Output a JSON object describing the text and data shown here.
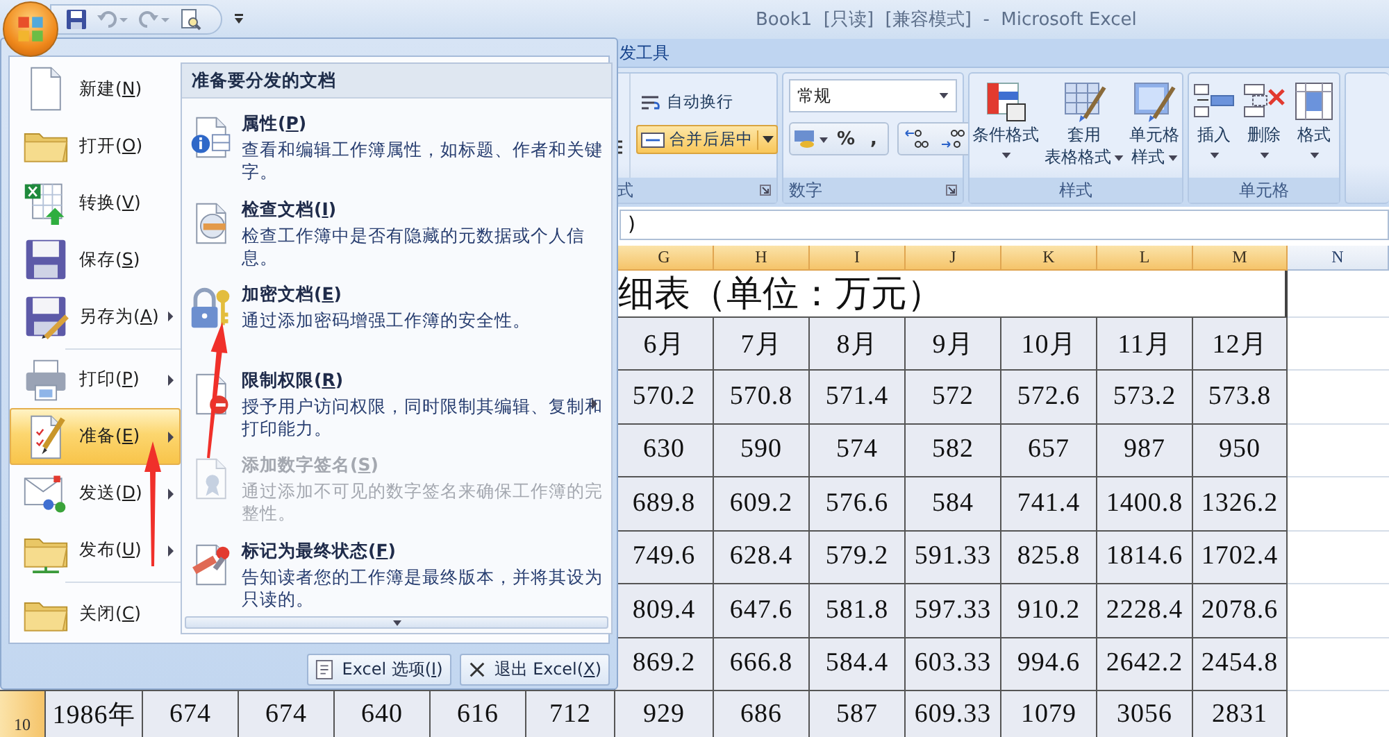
{
  "title_bar": {
    "title": "Book1  [只读]  [兼容模式]  -  Microsoft Excel"
  },
  "ribbon_tab": "发工具",
  "ribbon": {
    "alignment_group": {
      "label": "式",
      "wrap_button": "自动换行",
      "merge_button": {
        "label": "合并后居中",
        "selected": true
      }
    },
    "number_group": {
      "label": "数字",
      "format": "常规",
      "percent": "%",
      "comma": ","
    },
    "styles_group": {
      "label": "样式",
      "buttons": [
        {
          "lines": [
            "条件格式"
          ]
        },
        {
          "lines": [
            "套用",
            "表格格式"
          ]
        },
        {
          "lines": [
            "单元格",
            "样式"
          ]
        }
      ]
    },
    "cells_group": {
      "label": "单元格",
      "buttons": [
        "插入",
        "删除",
        "格式"
      ]
    }
  },
  "formula_bar": {
    "value": ")"
  },
  "sheet": {
    "columns": [
      {
        "label": "G",
        "selected": true
      },
      {
        "label": "H",
        "selected": true
      },
      {
        "label": "I",
        "selected": true
      },
      {
        "label": "J",
        "selected": true
      },
      {
        "label": "K",
        "selected": true
      },
      {
        "label": "L",
        "selected": true
      },
      {
        "label": "M",
        "selected": true
      },
      {
        "label": "N",
        "selected": false
      }
    ],
    "title": "细表（单位：万元）",
    "months": [
      "6月",
      "7月",
      "8月",
      "9月",
      "10月",
      "11月",
      "12月"
    ],
    "rows": [
      [
        "570.2",
        "570.8",
        "571.4",
        "572",
        "572.6",
        "573.2",
        "573.8"
      ],
      [
        "630",
        "590",
        "574",
        "582",
        "657",
        "987",
        "950"
      ],
      [
        "689.8",
        "609.2",
        "576.6",
        "584",
        "741.4",
        "1400.8",
        "1326.2"
      ],
      [
        "749.6",
        "628.4",
        "579.2",
        "591.33",
        "825.8",
        "1814.6",
        "1702.4"
      ],
      [
        "809.4",
        "647.6",
        "581.8",
        "597.33",
        "910.2",
        "2228.4",
        "2078.6"
      ],
      [
        "869.2",
        "666.8",
        "584.4",
        "603.33",
        "994.6",
        "2642.2",
        "2454.8"
      ]
    ],
    "bottom_row": {
      "header": "10",
      "selected": true,
      "cells": [
        "1986年",
        "674",
        "674",
        "640",
        "616",
        "712",
        "929",
        "686",
        "587",
        "609.33",
        "1079",
        "3056",
        "2831"
      ]
    }
  },
  "office_menu": {
    "items": [
      {
        "label": "新建(N)",
        "selected": false,
        "submenu": false
      },
      {
        "label": "打开(O)",
        "selected": false,
        "submenu": false
      },
      {
        "label": "转换(V)",
        "selected": false,
        "submenu": false
      },
      {
        "label": "保存(S)",
        "selected": false,
        "submenu": false
      },
      {
        "label": "另存为(A)",
        "selected": false,
        "submenu": true
      },
      {
        "label": "打印(P)",
        "selected": false,
        "submenu": true
      },
      {
        "label": "准备(E)",
        "selected": true,
        "submenu": true
      },
      {
        "label": "发送(D)",
        "selected": false,
        "submenu": true
      },
      {
        "label": "发布(U)",
        "selected": false,
        "submenu": true
      },
      {
        "label": "关闭(C)",
        "selected": false,
        "submenu": false
      }
    ],
    "panel": {
      "title": "准备要分发的文档",
      "items": [
        {
          "title": "属性(P)",
          "description": "查看和编辑工作簿属性，如标题、作者和关键字。",
          "disabled": false,
          "submenu": false
        },
        {
          "title": "检查文档(I)",
          "description": "检查工作簿中是否有隐藏的元数据或个人信息。",
          "disabled": false,
          "submenu": false
        },
        {
          "title": "加密文档(E)",
          "description": "通过添加密码增强工作簿的安全性。",
          "disabled": false,
          "submenu": false
        },
        {
          "title": "限制权限(R)",
          "description": "授予用户访问权限，同时限制其编辑、复制和打印能力。",
          "disabled": false,
          "submenu": true
        },
        {
          "title": "添加数字签名(S)",
          "description": "通过添加不可见的数字签名来确保工作簿的完整性。",
          "disabled": true,
          "submenu": false
        },
        {
          "title": "标记为最终状态(F)",
          "description": "告知读者您的工作簿是最终版本，并将其设为只读的。",
          "disabled": false,
          "submenu": false
        }
      ]
    },
    "footer_buttons": [
      "Excel 选项(I)",
      "退出 Excel(X)"
    ]
  }
}
